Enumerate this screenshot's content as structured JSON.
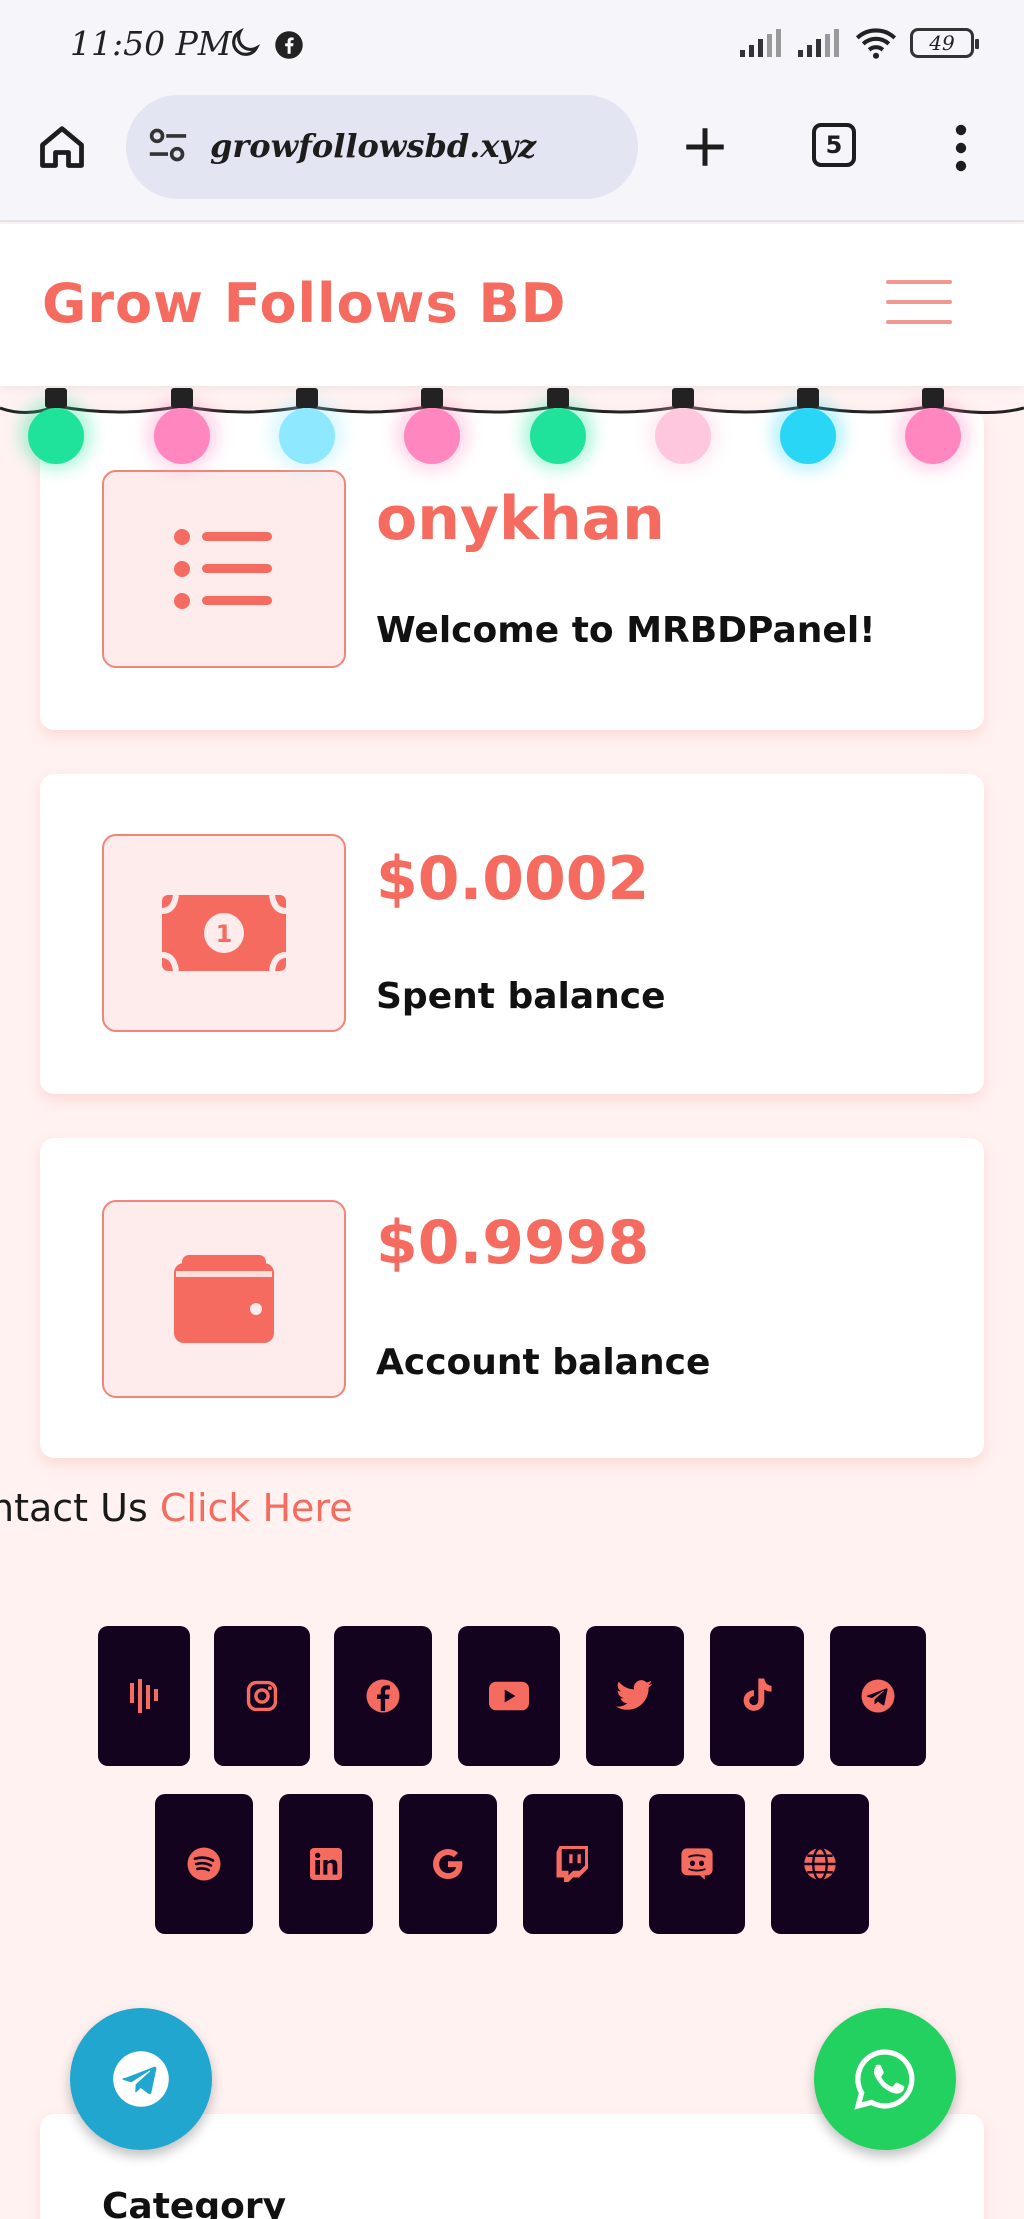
{
  "status_bar": {
    "time": "11:50 PM",
    "battery": "49"
  },
  "browser": {
    "url": "growfollowsbd.xyz",
    "tab_count": "5"
  },
  "site": {
    "brand": "Grow Follows BD"
  },
  "cards": [
    {
      "value": "onykhan",
      "label": "Welcome to MRBDPanel!",
      "icon": "list-icon"
    },
    {
      "value": "$0.0002",
      "label": "Spent balance",
      "icon": "money-bill-icon"
    },
    {
      "value": "$0.9998",
      "label": "Account balance",
      "icon": "wallet-icon"
    }
  ],
  "contact": {
    "prefix": "ntact Us",
    "link": "Click Here"
  },
  "social_row1": [
    "audiomack-icon",
    "instagram-icon",
    "facebook-icon",
    "youtube-icon",
    "twitter-icon",
    "tiktok-icon",
    "telegram-icon"
  ],
  "social_row2": [
    "spotify-icon",
    "linkedin-icon",
    "google-icon",
    "twitch-icon",
    "discord-icon",
    "globe-icon"
  ],
  "category": {
    "title": "Category"
  },
  "colors": {
    "accent": "#f56b60",
    "tile": "#13031f",
    "telegram": "#21a6cf",
    "whatsapp": "#23d160"
  }
}
